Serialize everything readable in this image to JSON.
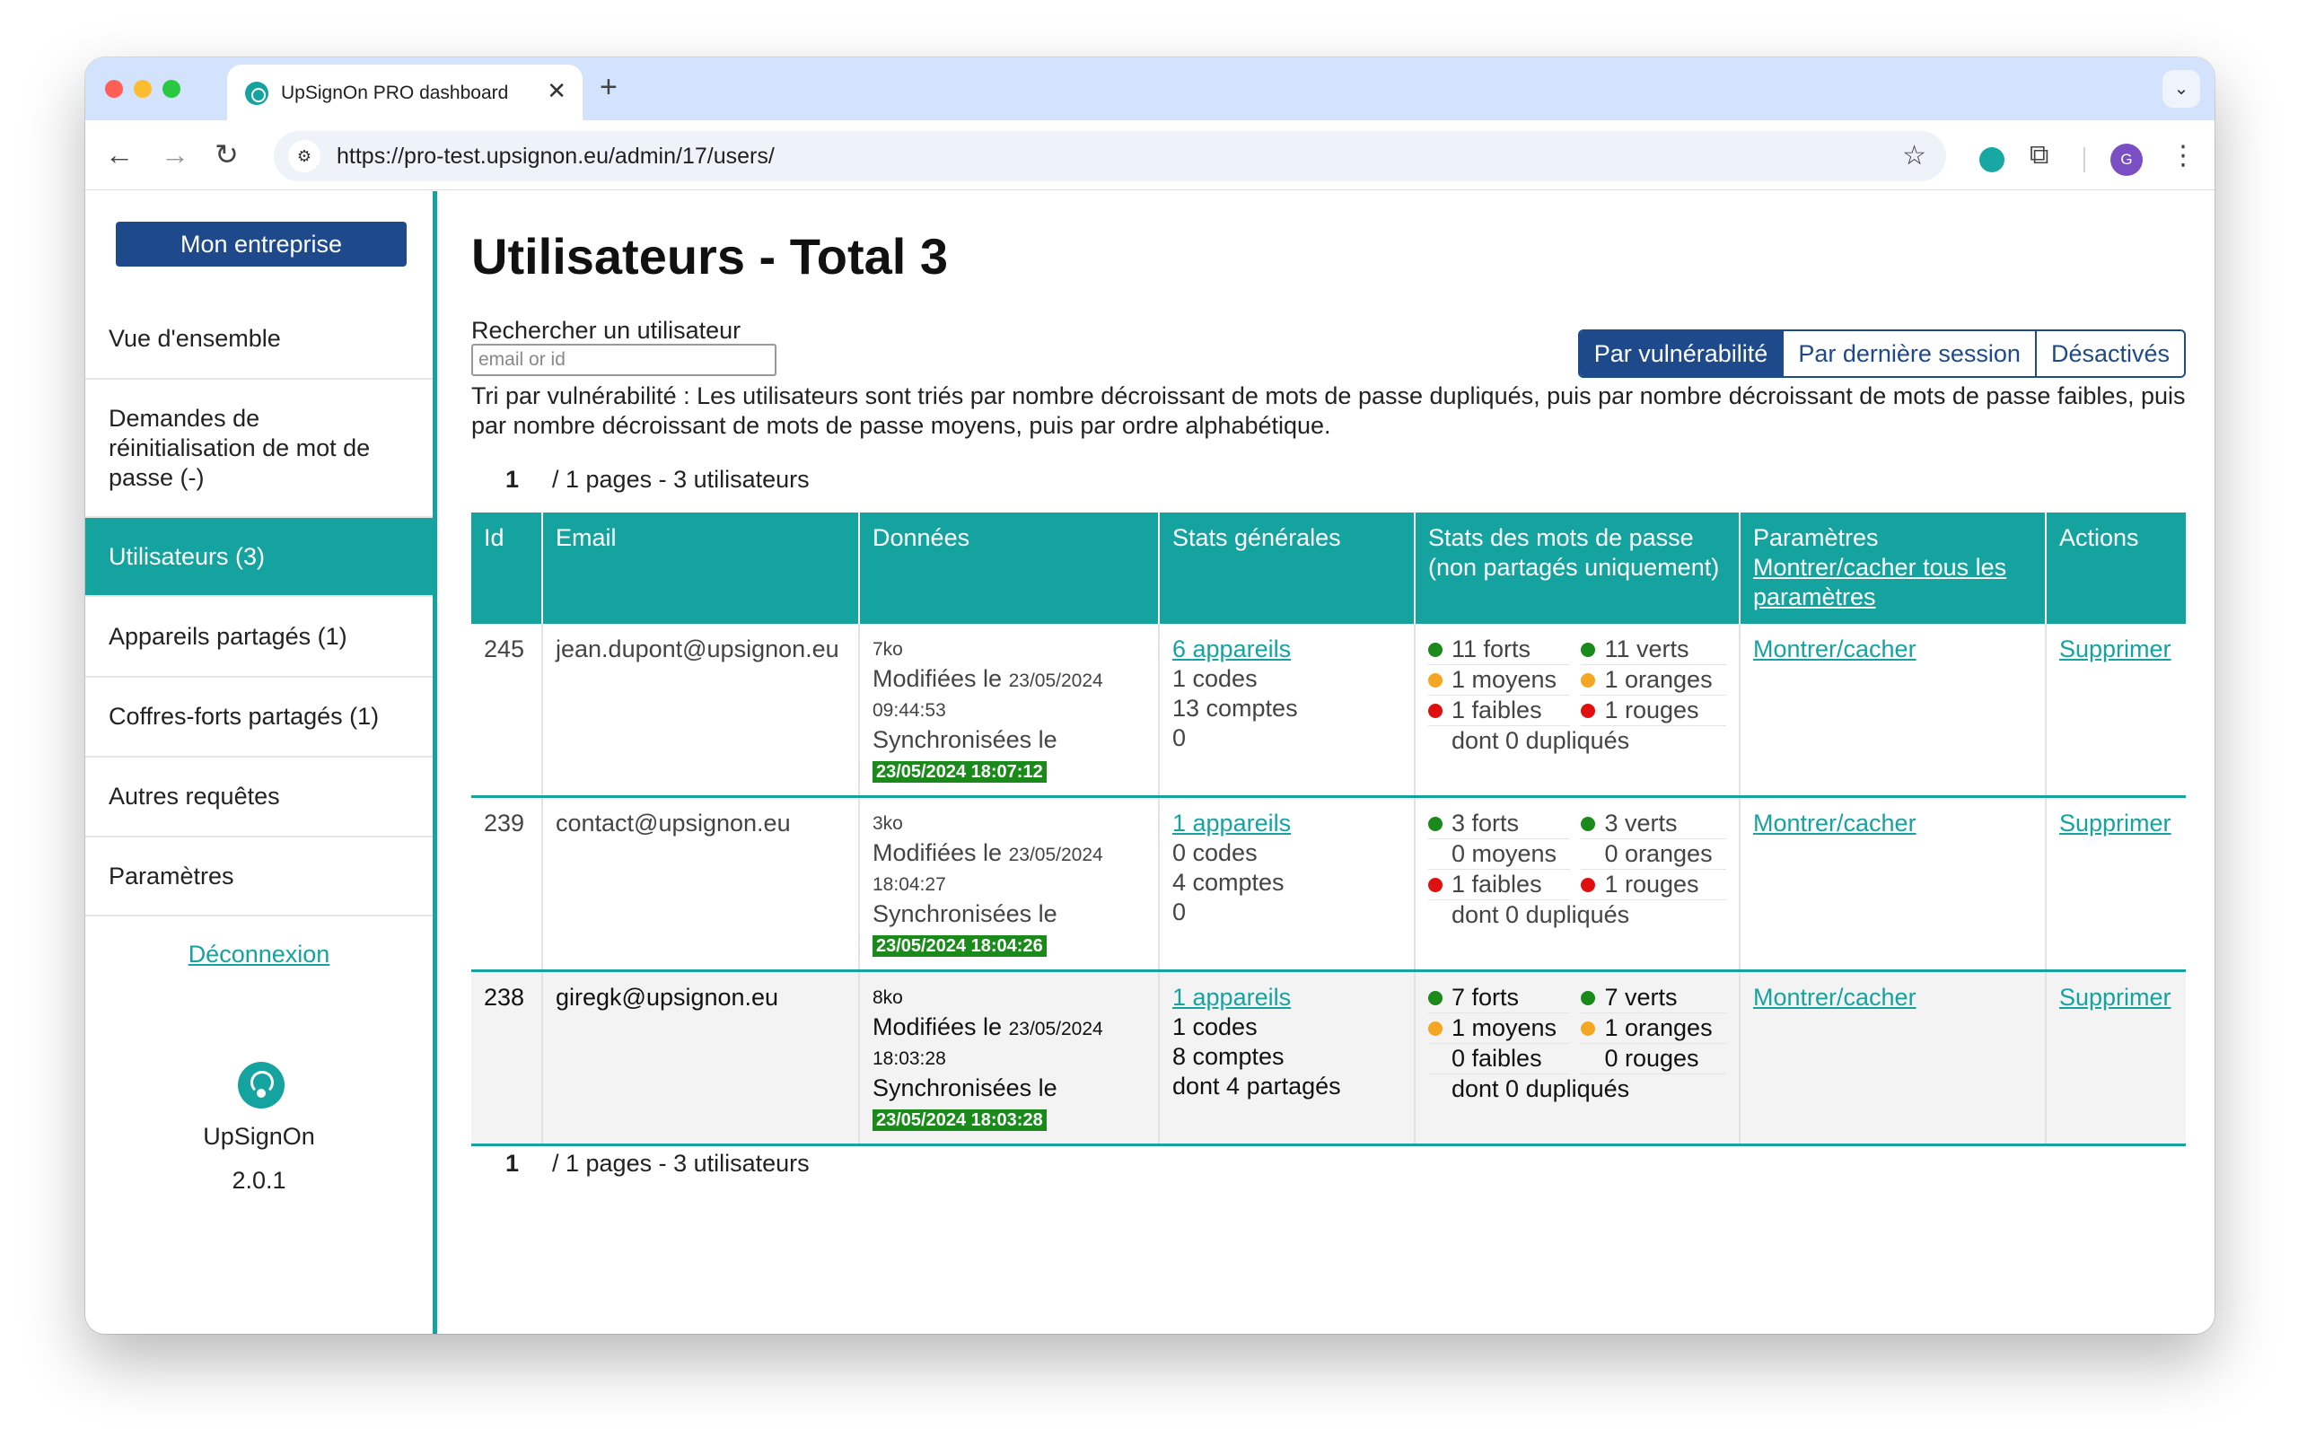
{
  "browser": {
    "tab_title": "UpSignOn PRO dashboard",
    "url": "https://pro-test.upsignon.eu/admin/17/users/",
    "avatar_letter": "G"
  },
  "sidebar": {
    "company_button": "Mon entreprise",
    "items": [
      {
        "label": "Vue d'ensemble",
        "active": false
      },
      {
        "label": "Demandes de réinitialisation de mot de passe (-)",
        "active": false
      },
      {
        "label": "Utilisateurs (3)",
        "active": true
      },
      {
        "label": "Appareils partagés (1)",
        "active": false
      },
      {
        "label": "Coffres-forts partagés (1)",
        "active": false
      },
      {
        "label": "Autres requêtes",
        "active": false
      },
      {
        "label": "Paramètres",
        "active": false
      }
    ],
    "logout": "Déconnexion",
    "brand_name": "UpSignOn",
    "version": "2.0.1"
  },
  "main": {
    "title": "Utilisateurs - Total 3",
    "search_label": "Rechercher un utilisateur",
    "search_placeholder": "email or id",
    "sort_buttons": [
      {
        "label": "Par vulnérabilité",
        "active": true
      },
      {
        "label": "Par dernière session",
        "active": false
      },
      {
        "label": "Désactivés",
        "active": false
      }
    ],
    "sort_description": "Tri par vulnérabilité : Les utilisateurs sont triés par nombre décroissant de mots de passe dupliqués, puis par nombre décroissant de mots de passe faibles, puis par nombre décroissant de mots de passe moyens, puis par ordre alphabétique.",
    "pager": {
      "page": "1",
      "text": "/ 1 pages - 3 utilisateurs"
    }
  },
  "table": {
    "headers": {
      "id": "Id",
      "email": "Email",
      "data": "Données",
      "general": "Stats générales",
      "passwords": "Stats des mots de passe (non partagés uniquement)",
      "params": "Paramètres",
      "params_link": "Montrer/cacher tous les paramètres",
      "actions": "Actions"
    },
    "rows": [
      {
        "id": "245",
        "email": "jean.dupont@upsignon.eu",
        "size": "7ko",
        "modified_label": "Modifiées le",
        "modified_date": "23/05/2024",
        "modified_time": "09:44:53",
        "sync_label": "Synchronisées le",
        "sync_value": "23/05/2024 18:07:12",
        "devices": "6 appareils",
        "codes": "1 codes",
        "accounts": "13 comptes",
        "shared": "0",
        "forts": "11 forts",
        "verts": "11 verts",
        "moyens": "1 moyens",
        "oranges": "1 oranges",
        "faibles": "1 faibles",
        "rouges": "1 rouges",
        "dup": "dont 0 dupliqués",
        "show_moyens": true,
        "show_oranges": true,
        "show_faibles": true,
        "show_rouges": true,
        "params_link": "Montrer/cacher",
        "delete": "Supprimer"
      },
      {
        "id": "239",
        "email": "contact@upsignon.eu",
        "size": "3ko",
        "modified_label": "Modifiées le",
        "modified_date": "23/05/2024",
        "modified_time": "18:04:27",
        "sync_label": "Synchronisées le",
        "sync_value": "23/05/2024 18:04:26",
        "devices": "1 appareils",
        "codes": "0 codes",
        "accounts": "4 comptes",
        "shared": "0",
        "forts": "3 forts",
        "verts": "3 verts",
        "moyens": "0 moyens",
        "oranges": "0 oranges",
        "faibles": "1 faibles",
        "rouges": "1 rouges",
        "dup": "dont 0 dupliqués",
        "show_moyens": false,
        "show_oranges": false,
        "show_faibles": true,
        "show_rouges": true,
        "params_link": "Montrer/cacher",
        "delete": "Supprimer"
      },
      {
        "id": "238",
        "email": "giregk@upsignon.eu",
        "size": "8ko",
        "modified_label": "Modifiées le",
        "modified_date": "23/05/2024",
        "modified_time": "18:03:28",
        "sync_label": "Synchronisées le",
        "sync_value": "23/05/2024 18:03:28",
        "devices": "1 appareils",
        "codes": "1 codes",
        "accounts": "8 comptes",
        "shared": "dont 4 partagés",
        "forts": "7 forts",
        "verts": "7 verts",
        "moyens": "1 moyens",
        "oranges": "1 oranges",
        "faibles": "0 faibles",
        "rouges": "0 rouges",
        "dup": "dont 0 dupliqués",
        "show_moyens": true,
        "show_oranges": true,
        "show_faibles": false,
        "show_rouges": false,
        "params_link": "Montrer/cacher",
        "delete": "Supprimer"
      }
    ]
  },
  "colors": {
    "teal": "#15a3a0",
    "navy": "#1e4a8c",
    "green": "#1a8a1a",
    "orange": "#f5a623",
    "red": "#e01010"
  }
}
